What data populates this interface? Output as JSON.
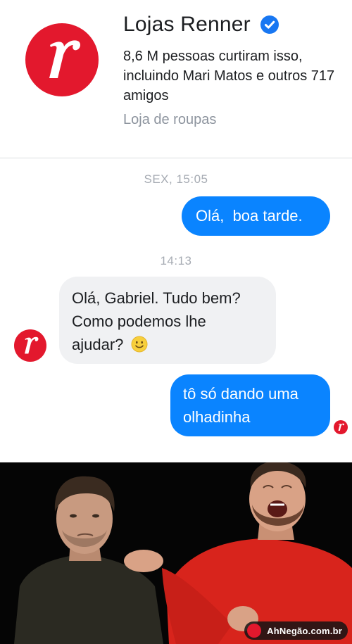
{
  "page": {
    "name": "Lojas Renner",
    "likes": "8,6 M pessoas curtiram isso, incluindo Mari Matos e outros 717 amigos",
    "category": "Loja de roupas",
    "brand_color": "#e3182d",
    "verified_color": "#1877f2"
  },
  "conversation": {
    "messages": [
      {
        "type": "timestamp",
        "text": "SEX, 15:05"
      },
      {
        "type": "outgoing",
        "text": "Olá,  boa tarde."
      },
      {
        "type": "timestamp",
        "text": "14:13"
      },
      {
        "type": "incoming",
        "lines": [
          "Olá, Gabriel. Tudo bem?",
          "Como podemos lhe",
          "ajudar?"
        ],
        "emoji": "slightly-smiling-face"
      },
      {
        "type": "outgoing",
        "lines": [
          "tô só dando uma",
          "olhadinha"
        ]
      }
    ],
    "outgoing_color": "#0a84ff",
    "incoming_color": "#f0f1f3"
  },
  "meme": {
    "watermark": "AhNegão.com.br"
  }
}
